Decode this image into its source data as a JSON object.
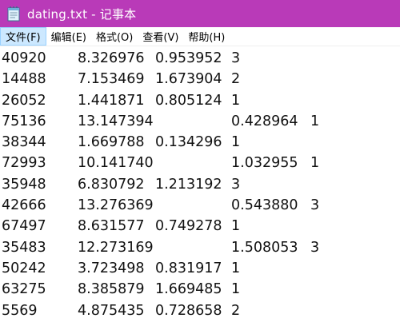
{
  "window": {
    "title": "dating.txt - 记事本",
    "title_bar_color": "#b93ab8",
    "icon": "notepad-icon"
  },
  "menu": {
    "items": [
      {
        "label": "文件(F)",
        "active": true
      },
      {
        "label": "编辑(E)",
        "active": false
      },
      {
        "label": "格式(O)",
        "active": false
      },
      {
        "label": "查看(V)",
        "active": false
      },
      {
        "label": "帮助(H)",
        "active": false
      }
    ]
  },
  "content": {
    "lines": [
      [
        "40920",
        "8.326976",
        "0.953952",
        "3",
        ""
      ],
      [
        "14488",
        "7.153469",
        "1.673904",
        "2",
        ""
      ],
      [
        "26052",
        "1.441871",
        "0.805124",
        "1",
        ""
      ],
      [
        "75136",
        "13.147394",
        "",
        "0.428964",
        "1"
      ],
      [
        "38344",
        "1.669788",
        "0.134296",
        "1",
        ""
      ],
      [
        "72993",
        "10.141740",
        "",
        "1.032955",
        "1"
      ],
      [
        "35948",
        "6.830792",
        "1.213192",
        "3",
        ""
      ],
      [
        "42666",
        "13.276369",
        "",
        "0.543880",
        "3"
      ],
      [
        "67497",
        "8.631577",
        "0.749278",
        "1",
        ""
      ],
      [
        "35483",
        "12.273169",
        "",
        "1.508053",
        "3"
      ],
      [
        "50242",
        "3.723498",
        "0.831917",
        "1",
        ""
      ],
      [
        "63275",
        "8.385879",
        "1.669485",
        "1",
        ""
      ],
      [
        "5569",
        "4.875435",
        "0.728658",
        "2",
        ""
      ]
    ]
  }
}
